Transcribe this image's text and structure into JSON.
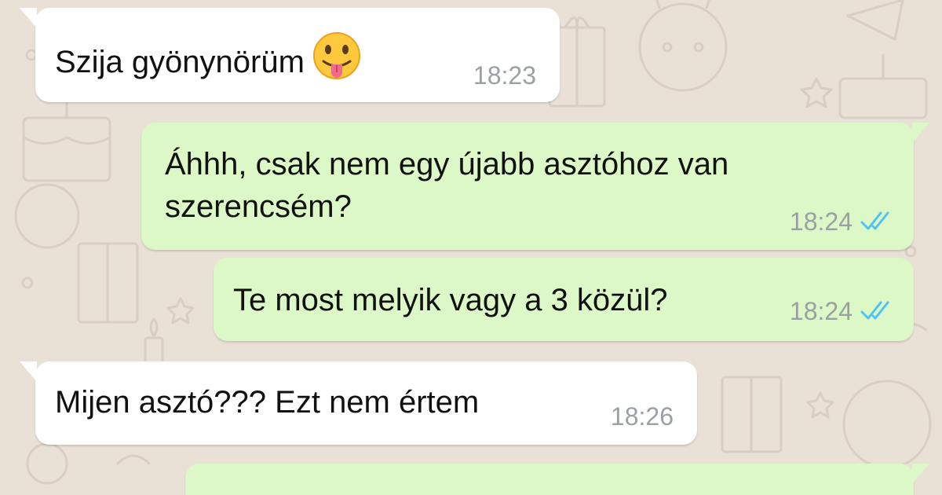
{
  "chat": {
    "messages": [
      {
        "direction": "incoming",
        "text": "Szija gyönynörüm",
        "emoji": "face-with-tongue",
        "time": "18:23"
      },
      {
        "direction": "outgoing",
        "lines": [
          "Áhhh, csak nem egy újabb asztóhoz van",
          "szerencsém?"
        ],
        "time": "18:24",
        "status": "read"
      },
      {
        "direction": "outgoing",
        "text": "Te most melyik vagy a 3 közül?",
        "time": "18:24",
        "status": "read"
      },
      {
        "direction": "incoming",
        "text": "Mijen asztó??? Ezt nem értem",
        "time": "18:26"
      },
      {
        "direction": "outgoing",
        "text": "",
        "partial": true
      }
    ]
  },
  "colors": {
    "wallpaper": "#e9e1d6",
    "incoming_bubble": "#ffffff",
    "outgoing_bubble": "#dcf8c6",
    "read_ticks": "#4fc3f7",
    "timestamp": "#9aa0a4"
  }
}
